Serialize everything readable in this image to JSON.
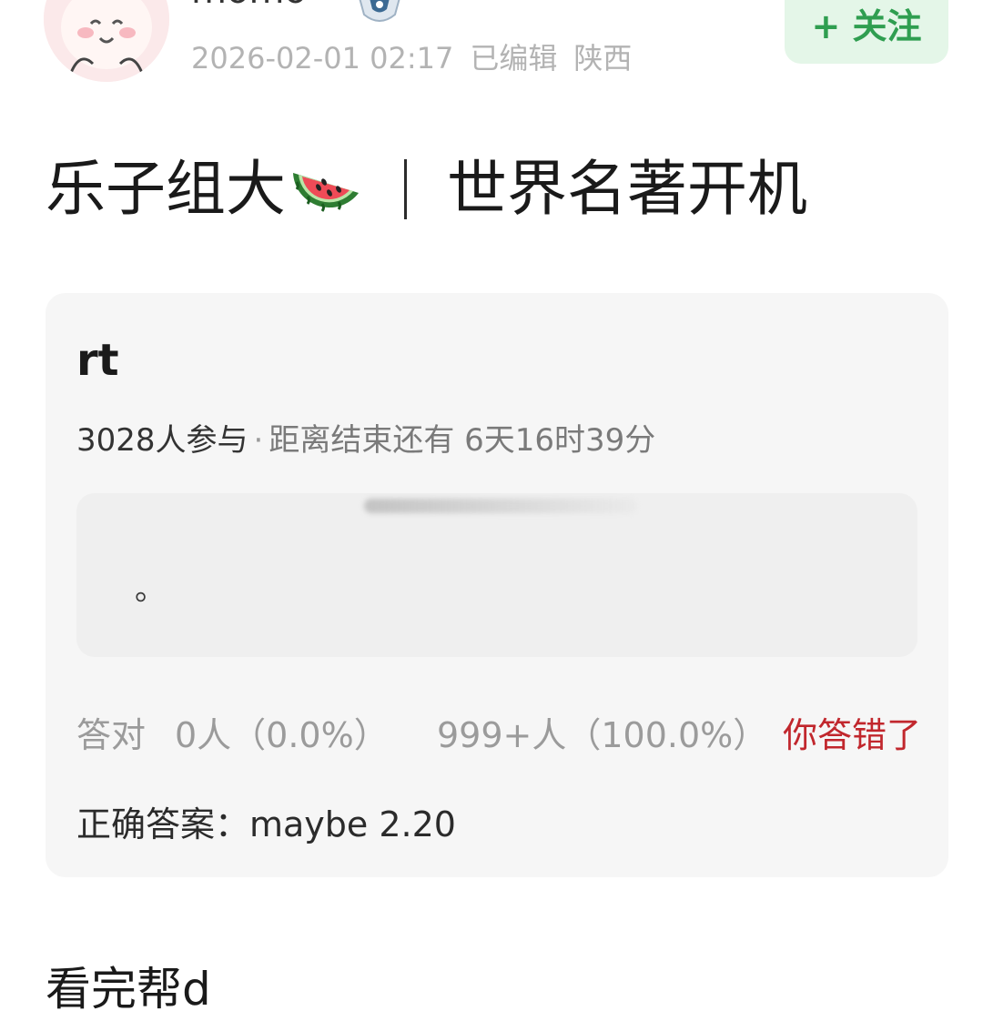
{
  "author": {
    "name": "momo",
    "avatar_icon": "cute-character-avatar",
    "badge_icon": "verified-badge-icon",
    "timestamp": "2026-02-01 02:17",
    "edited_label": "已编辑",
    "location": "陕西"
  },
  "follow_button": {
    "label": "+ 关注",
    "color": "#2f9e50",
    "background": "#e4f6e8"
  },
  "post": {
    "title_left": "乐子组大",
    "title_emoji": "watermelon-emoji",
    "title_right": "世界名著开机",
    "body_text": "看完帮d"
  },
  "quiz": {
    "question": "rt",
    "participants": "3028人参与",
    "separator": "·",
    "countdown": "距离结束还有 6天16时39分",
    "option_text": "。",
    "correct_label": "答对",
    "correct_stats": "0人（0.0%）",
    "wrong_stats": "999+人（100.0%）",
    "wrong_tag": "你答错了",
    "wrong_tag_color": "#c1272d",
    "answer_label": "正确答案：",
    "answer_value": "maybe 2.20",
    "correct_answer_full": "正确答案：maybe 2.20"
  }
}
